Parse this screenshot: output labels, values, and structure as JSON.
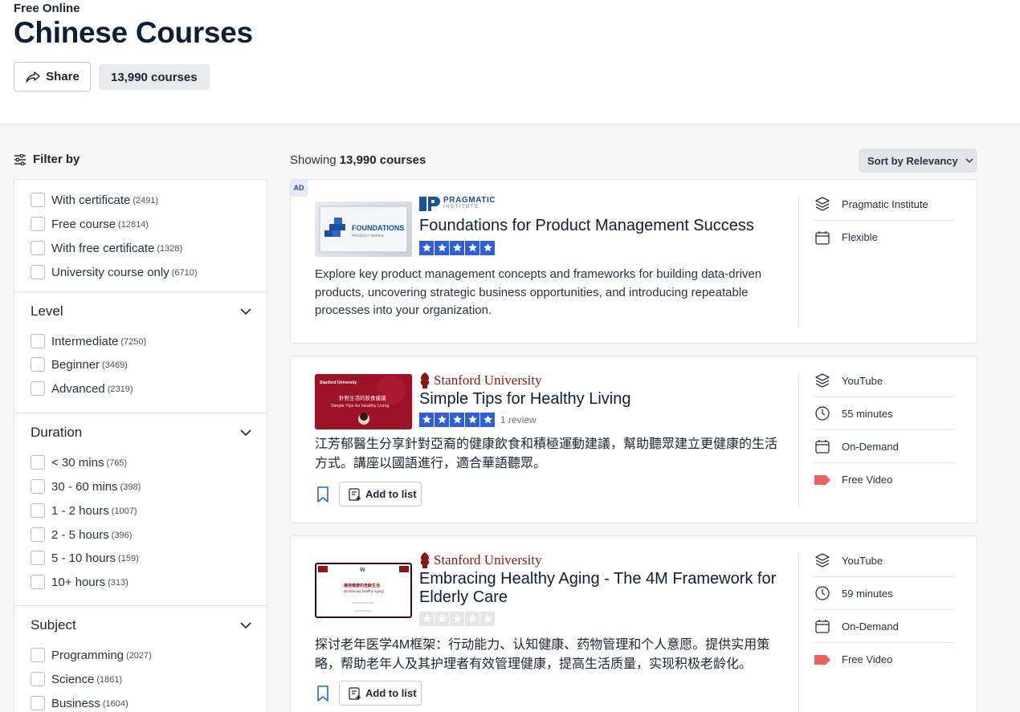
{
  "hero": {
    "kicker": "Free Online",
    "title": "Chinese Courses",
    "share_label": "Share",
    "course_count": "13,990 courses"
  },
  "filters": {
    "label": "Filter by",
    "top_options": [
      {
        "label": "With certificate",
        "count": "(2491)"
      },
      {
        "label": "Free course",
        "count": "(12814)"
      },
      {
        "label": "With free certificate",
        "count": "(1328)"
      },
      {
        "label": "University course only",
        "count": "(6710)"
      }
    ],
    "level": {
      "title": "Level",
      "options": [
        {
          "label": "Intermediate",
          "count": "(7250)"
        },
        {
          "label": "Beginner",
          "count": "(3469)"
        },
        {
          "label": "Advanced",
          "count": "(2319)"
        }
      ]
    },
    "duration": {
      "title": "Duration",
      "options": [
        {
          "label": "< 30 mins",
          "count": "(765)"
        },
        {
          "label": "30 - 60 mins",
          "count": "(398)"
        },
        {
          "label": "1 - 2 hours",
          "count": "(1007)"
        },
        {
          "label": "2 - 5 hours",
          "count": "(396)"
        },
        {
          "label": "5 - 10 hours",
          "count": "(159)"
        },
        {
          "label": "10+ hours",
          "count": "(313)"
        }
      ]
    },
    "subject": {
      "title": "Subject",
      "options": [
        {
          "label": "Programming",
          "count": "(2027)"
        },
        {
          "label": "Science",
          "count": "(1861)"
        },
        {
          "label": "Business",
          "count": "(1604)"
        }
      ]
    }
  },
  "results": {
    "showing_prefix": "Showing",
    "showing_count": "13,990 courses",
    "sort_label": "Sort by Relevancy"
  },
  "courses": [
    {
      "ad": "AD",
      "provider": "PRAGMATIC",
      "provider_sub": "INSTITUTE",
      "thumb_text": "FOUNDATIONS",
      "thumb_sub": "PRODUCT SERIES",
      "title": "Foundations for Product Management Success",
      "rating": 5,
      "description": "Explore key product management concepts and frameworks for building data-driven products, uncovering strategic business opportunities, and introducing repeatable processes into your organization.",
      "meta": [
        {
          "icon": "layers-icon",
          "label": "Pragmatic Institute"
        },
        {
          "icon": "calendar-icon",
          "label": "Flexible"
        }
      ]
    },
    {
      "provider": "Stanford University",
      "thumb_text": "針對生活的飲食建議",
      "thumb_sub": "Simple Tips for Healthy Living",
      "title": "Simple Tips for Healthy Living",
      "rating": 5,
      "review_text": "1 review",
      "description": "江芳郁醫生分享針對亞裔的健康飲食和積極運動建議，幫助聽眾建立更健康的生活方式。講座以國語進行，適合華語聽眾。",
      "add_to_list": "Add to list",
      "meta": [
        {
          "icon": "layers-icon",
          "label": "YouTube"
        },
        {
          "icon": "clock-icon",
          "label": "55 minutes"
        },
        {
          "icon": "calendar-icon",
          "label": "On-Demand"
        },
        {
          "icon": "video-icon",
          "label": "Free Video"
        }
      ]
    },
    {
      "provider": "Stanford University",
      "thumb_text": "擁抱健康的老齡生活",
      "thumb_sub": "(Embracing Healthy Aging)",
      "title": "Embracing Healthy Aging - The 4M Framework for Elderly Care",
      "rating": 0,
      "description": "探讨老年医学4M框架：行动能力、认知健康、药物管理和个人意愿。提供实用策略，帮助老年人及其护理者有效管理健康，提高生活质量，实现积极老龄化。",
      "add_to_list": "Add to list",
      "meta": [
        {
          "icon": "layers-icon",
          "label": "YouTube"
        },
        {
          "icon": "clock-icon",
          "label": "59 minutes"
        },
        {
          "icon": "calendar-icon",
          "label": "On-Demand"
        },
        {
          "icon": "video-icon",
          "label": "Free Video"
        }
      ]
    }
  ],
  "colors": {
    "star_filled": "#2f5fd6",
    "star_empty": "#e4e6ea",
    "stanford_red": "#8c1515",
    "video_red": "#f06060",
    "pragmatic_blue": "#1b4fa0"
  }
}
